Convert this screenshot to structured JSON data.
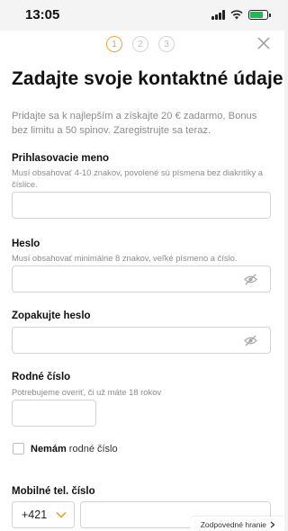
{
  "status_bar": {
    "time": "13:05"
  },
  "steps": [
    "1",
    "2",
    "3"
  ],
  "title": "Zadajte svoje kontaktné údaje",
  "intro": "Pridajte sa k najlepším a získajte 20 € zadarmo, Bonus bez limitu a 50 spinov. Zaregistrujte sa teraz.",
  "username": {
    "label": "Prihlasovacie meno",
    "hint": "Musí obsahovať 4-10 znakov, povolené sú písmena bez diakritiky a číslice.",
    "value": ""
  },
  "password": {
    "label": "Heslo",
    "hint": "Musí obsahovať minimálne 8 znakov, veľké písmeno a číslo.",
    "value": ""
  },
  "password_repeat": {
    "label": "Zopakujte heslo",
    "value": ""
  },
  "birth_number": {
    "label": "Rodné číslo",
    "hint": "Potrebujeme overiť, či už máte 18 rokov",
    "value": ""
  },
  "no_birth_number": {
    "bold": "Nemám",
    "rest": " rodné číslo",
    "checked": false
  },
  "phone": {
    "label": "Mobilné tel. číslo",
    "prefix": "+421",
    "value": ""
  },
  "footer": {
    "link": "Zodpovedné hranie"
  },
  "colors": {
    "accent": "#f0a43a",
    "text": "#111111",
    "muted": "#8c8c8c",
    "border": "#d4d4d4"
  }
}
